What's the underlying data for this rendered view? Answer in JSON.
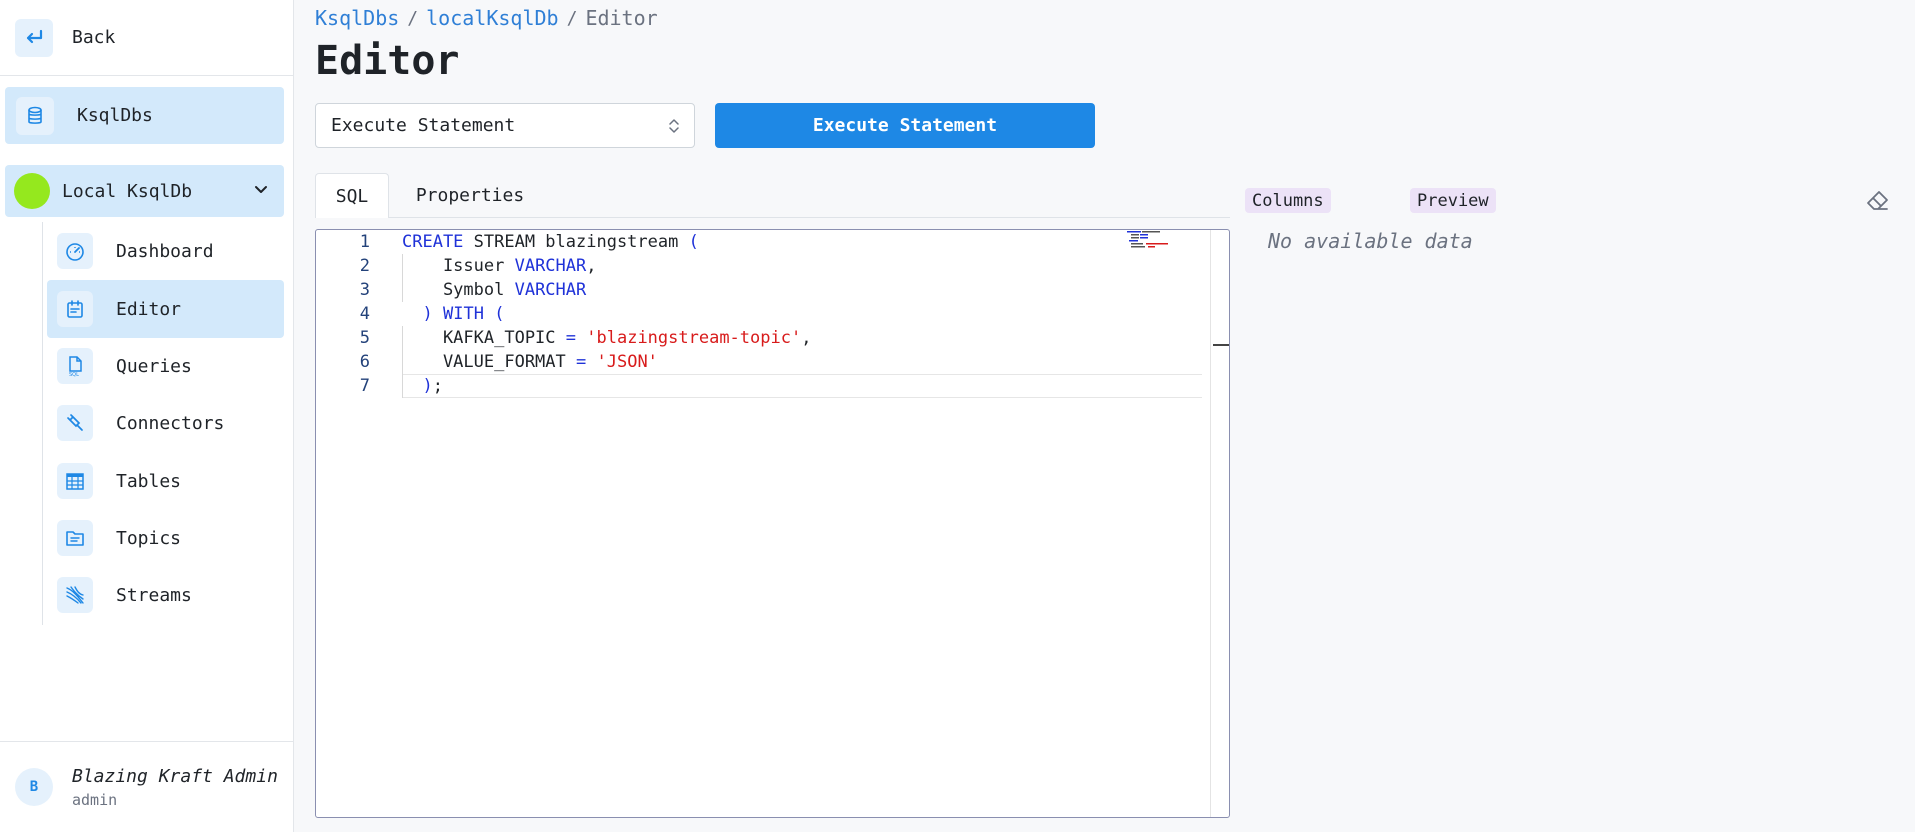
{
  "sidebar": {
    "back_label": "Back",
    "top_item": "KsqlDbs",
    "group": {
      "label": "Local KsqlDb",
      "status_color": "#95e81e"
    },
    "items": [
      {
        "label": "Dashboard",
        "icon": "dashboard-gauge-icon",
        "active": false
      },
      {
        "label": "Editor",
        "icon": "calendar-editor-icon",
        "active": true
      },
      {
        "label": "Queries",
        "icon": "sql-file-icon",
        "active": false
      },
      {
        "label": "Connectors",
        "icon": "plug-icon",
        "active": false
      },
      {
        "label": "Tables",
        "icon": "table-grid-icon",
        "active": false
      },
      {
        "label": "Topics",
        "icon": "topic-folder-icon",
        "active": false
      },
      {
        "label": "Streams",
        "icon": "streams-icon",
        "active": false
      }
    ],
    "user": {
      "avatar": "B",
      "name": "Blazing Kraft Admin",
      "role": "admin"
    }
  },
  "breadcrumb": {
    "root": "KsqlDbs",
    "parent": "localKsqlDb",
    "current": "Editor"
  },
  "page": {
    "title": "Editor"
  },
  "toolbar": {
    "select_value": "Execute Statement",
    "execute_label": "Execute Statement"
  },
  "tabs": [
    {
      "label": "SQL",
      "active": true
    },
    {
      "label": "Properties",
      "active": false
    }
  ],
  "editor": {
    "line_numbers": [
      "1",
      "2",
      "3",
      "4",
      "5",
      "6",
      "7"
    ],
    "lines": [
      "CREATE STREAM blazingstream (",
      "    Issuer VARCHAR,",
      "    Symbol VARCHAR",
      "  ) WITH (",
      "    KAFKA_TOPIC = 'blazingstream-topic',",
      "    VALUE_FORMAT = 'JSON'",
      "  );"
    ]
  },
  "result": {
    "columns_label": "Columns",
    "preview_label": "Preview",
    "empty_text": "No available data"
  },
  "colors": {
    "accent": "#1e88e5",
    "active_bg": "#d3e9fb",
    "keyword": "#1f32d8",
    "string": "#d81b1b"
  }
}
